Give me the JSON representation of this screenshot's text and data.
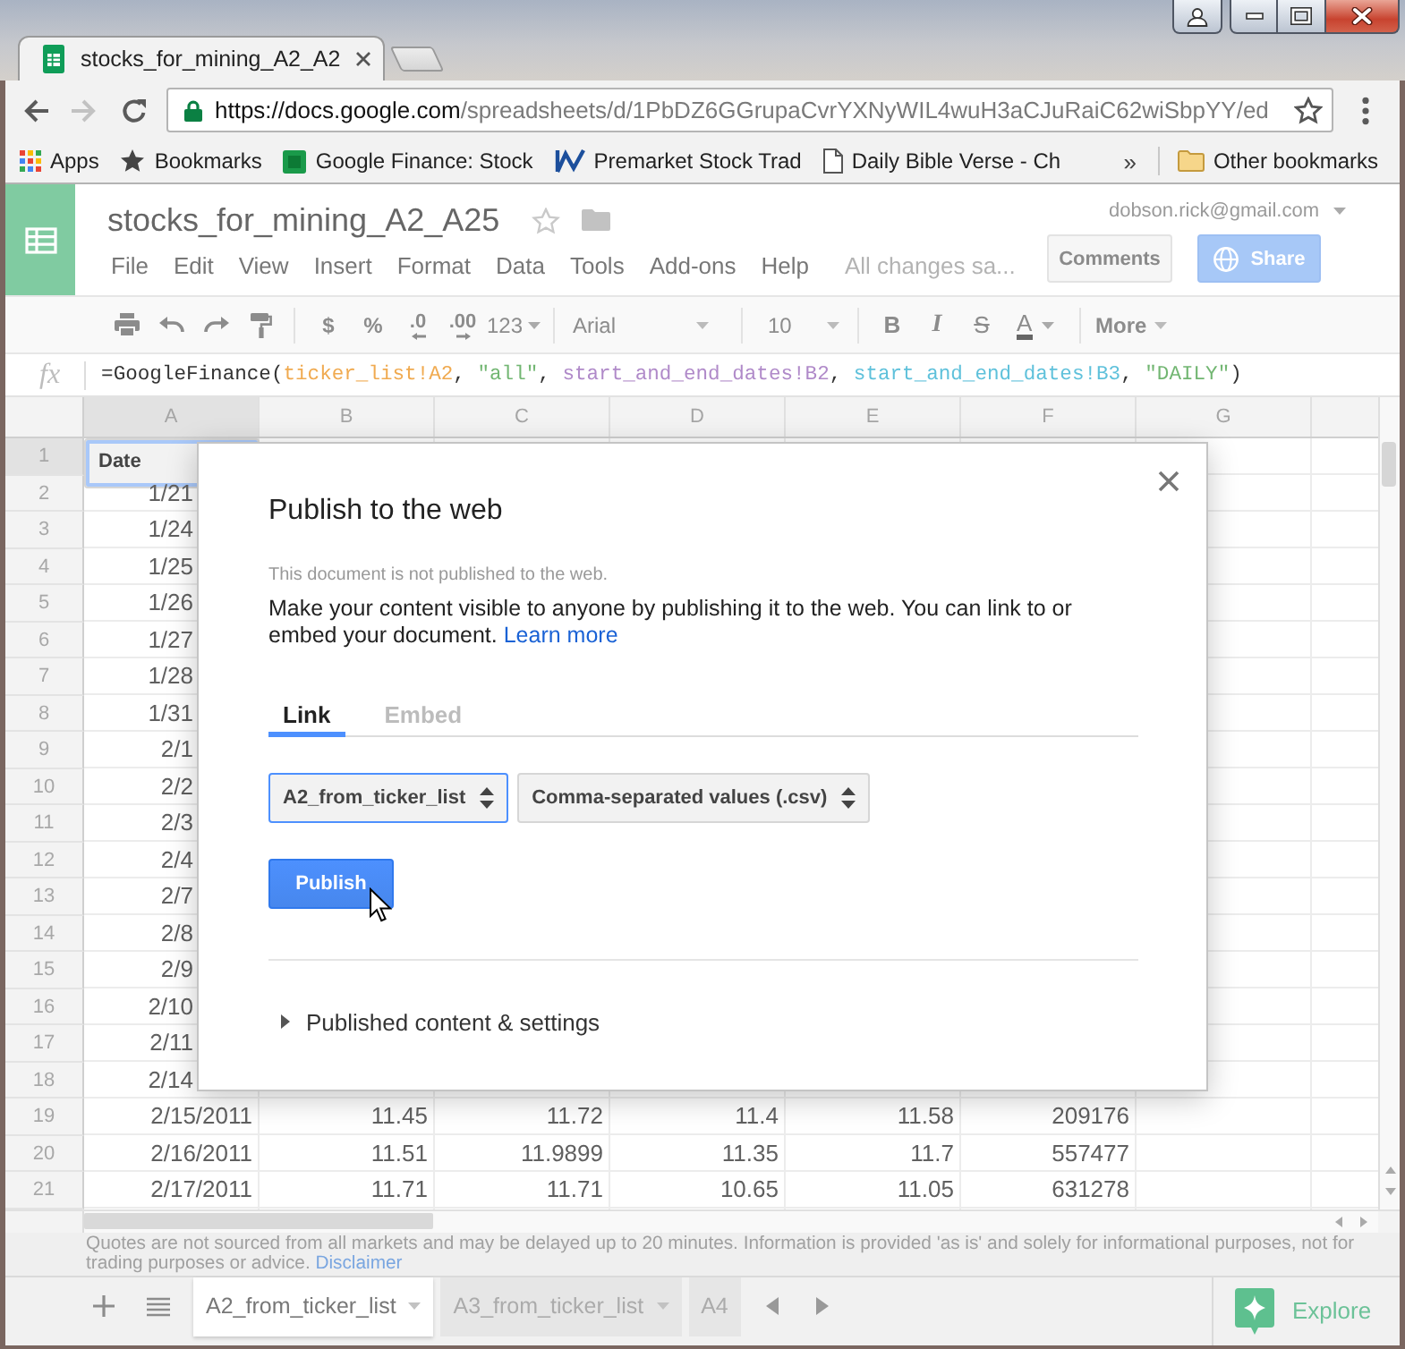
{
  "browser": {
    "tab": {
      "title": "stocks_for_mining_A2_A2"
    },
    "address": {
      "url": "https://docs.google.com/spreadsheets/d/1PbDZ6GGrupaCvrYXNyWIL4wuH3aCJuRaiC62wiSbpYY/ed"
    },
    "bookmarks": [
      {
        "label": "Apps",
        "kind": "apps"
      },
      {
        "label": "Bookmarks",
        "kind": "star"
      },
      {
        "label": "Google Finance: Stock",
        "kind": "sheet"
      },
      {
        "label": "Premarket Stock Trad",
        "kind": "chart"
      },
      {
        "label": "Daily Bible Verse - Ch",
        "kind": "page"
      }
    ],
    "overflow": "»",
    "other_bookmarks": "Other bookmarks"
  },
  "header": {
    "title": "stocks_for_mining_A2_A25",
    "menu": [
      "File",
      "Edit",
      "View",
      "Insert",
      "Format",
      "Data",
      "Tools",
      "Add-ons",
      "Help"
    ],
    "save_status": "All changes sa...",
    "account": "dobson.rick@gmail.com",
    "comments_button": "Comments",
    "share_button": "Share"
  },
  "toolbar": {
    "currency": "$",
    "percent": "%",
    "decimal_less": ".0",
    "decimal_more": ".00",
    "number_format": "123",
    "font": "Arial",
    "font_size": "10",
    "bold": "B",
    "italic": "I",
    "strikethrough": "S",
    "text_color": "A",
    "more": "More"
  },
  "formula_bar": {
    "label": "fx",
    "segments": [
      {
        "text": "=GoogleFinance(",
        "color": "#333333"
      },
      {
        "text": "ticker_list!A2",
        "color": "#f0aa50"
      },
      {
        "text": ", ",
        "color": "#333333"
      },
      {
        "text": "\"all\"",
        "color": "#72b672"
      },
      {
        "text": ", ",
        "color": "#333333"
      },
      {
        "text": "start_and_end_dates!B2",
        "color": "#b08ac9"
      },
      {
        "text": ", ",
        "color": "#333333"
      },
      {
        "text": "start_and_end_dates!B3",
        "color": "#5fc1db"
      },
      {
        "text": ", ",
        "color": "#333333"
      },
      {
        "text": "\"DAILY\"",
        "color": "#72b672"
      },
      {
        "text": ")",
        "color": "#333333"
      }
    ]
  },
  "grid": {
    "columns": [
      "A",
      "B",
      "C",
      "D",
      "E",
      "F",
      "G"
    ],
    "rows": [
      {
        "number": "1",
        "cells": [
          {
            "text": "Date",
            "kind": "text",
            "selected": true
          }
        ]
      },
      {
        "number": "2",
        "cells": [
          {
            "text": "1/21",
            "kind": "number",
            "selected": false
          }
        ]
      },
      {
        "number": "3",
        "cells": [
          {
            "text": "1/24",
            "kind": "number",
            "selected": false
          }
        ]
      },
      {
        "number": "4",
        "cells": [
          {
            "text": "1/25",
            "kind": "number",
            "selected": false
          }
        ]
      },
      {
        "number": "5",
        "cells": [
          {
            "text": "1/26",
            "kind": "number",
            "selected": false
          }
        ]
      },
      {
        "number": "6",
        "cells": [
          {
            "text": "1/27",
            "kind": "number",
            "selected": false
          }
        ]
      },
      {
        "number": "7",
        "cells": [
          {
            "text": "1/28",
            "kind": "number",
            "selected": false
          }
        ]
      },
      {
        "number": "8",
        "cells": [
          {
            "text": "1/31",
            "kind": "number",
            "selected": false
          }
        ]
      },
      {
        "number": "9",
        "cells": [
          {
            "text": "2/1",
            "kind": "number",
            "selected": false
          }
        ]
      },
      {
        "number": "10",
        "cells": [
          {
            "text": "2/2",
            "kind": "number",
            "selected": false
          }
        ]
      },
      {
        "number": "11",
        "cells": [
          {
            "text": "2/3",
            "kind": "number",
            "selected": false
          }
        ]
      },
      {
        "number": "12",
        "cells": [
          {
            "text": "2/4",
            "kind": "number",
            "selected": false
          }
        ]
      },
      {
        "number": "13",
        "cells": [
          {
            "text": "2/7",
            "kind": "number",
            "selected": false
          }
        ]
      },
      {
        "number": "14",
        "cells": [
          {
            "text": "2/8",
            "kind": "number",
            "selected": false
          }
        ]
      },
      {
        "number": "15",
        "cells": [
          {
            "text": "2/9",
            "kind": "number",
            "selected": false
          }
        ]
      },
      {
        "number": "16",
        "cells": [
          {
            "text": "2/10",
            "kind": "number",
            "selected": false
          }
        ]
      },
      {
        "number": "17",
        "cells": [
          {
            "text": "2/11",
            "kind": "number",
            "selected": false
          }
        ]
      },
      {
        "number": "18",
        "cells": [
          {
            "text": "2/14",
            "kind": "number",
            "selected": false
          }
        ]
      },
      {
        "number": "19",
        "cells": [
          {
            "text": "2/15/2011",
            "kind": "number",
            "selected": false
          },
          {
            "text": "11.45",
            "kind": "number",
            "selected": false
          },
          {
            "text": "11.72",
            "kind": "number",
            "selected": false
          },
          {
            "text": "11.4",
            "kind": "number",
            "selected": false
          },
          {
            "text": "11.58",
            "kind": "number",
            "selected": false
          },
          {
            "text": "209176",
            "kind": "number",
            "selected": false
          }
        ]
      },
      {
        "number": "20",
        "cells": [
          {
            "text": "2/16/2011",
            "kind": "number",
            "selected": false
          },
          {
            "text": "11.51",
            "kind": "number",
            "selected": false
          },
          {
            "text": "11.9899",
            "kind": "number",
            "selected": false
          },
          {
            "text": "11.35",
            "kind": "number",
            "selected": false
          },
          {
            "text": "11.7",
            "kind": "number",
            "selected": false
          },
          {
            "text": "557477",
            "kind": "number",
            "selected": false
          }
        ]
      },
      {
        "number": "21",
        "cells": [
          {
            "text": "2/17/2011",
            "kind": "number",
            "selected": false
          },
          {
            "text": "11.71",
            "kind": "number",
            "selected": false
          },
          {
            "text": "11.71",
            "kind": "number",
            "selected": false
          },
          {
            "text": "10.65",
            "kind": "number",
            "selected": false
          },
          {
            "text": "11.05",
            "kind": "number",
            "selected": false
          },
          {
            "text": "631278",
            "kind": "number",
            "selected": false
          }
        ]
      }
    ]
  },
  "footer": {
    "disclaimer": "Quotes are not sourced from all markets and may be delayed up to 20 minutes. Information is provided 'as is' and solely for informational purposes, not for trading purposes or advice.",
    "disclaimer_link": "Disclaimer"
  },
  "sheet_tabs": [
    {
      "label": "A2_from_ticker_list",
      "selected": true
    },
    {
      "label": "A3_from_ticker_list",
      "selected": false
    },
    {
      "label": "A4",
      "selected": false
    }
  ],
  "explore": "Explore",
  "dialog": {
    "title": "Publish to the web",
    "status": "This document is not published to the web.",
    "description": "Make your content visible to anyone by publishing it to the web. You can link to or embed your document.",
    "link": "Learn more",
    "tabs": [
      {
        "label": "Link",
        "selected": true
      },
      {
        "label": "Embed",
        "selected": false
      }
    ],
    "selects": [
      {
        "value": "A2_from_ticker_list",
        "focused": true
      },
      {
        "value": "Comma-separated values (.csv)",
        "focused": false
      }
    ],
    "publish_button": "Publish",
    "section": {
      "label": "Published content & settings",
      "expanded": false
    }
  }
}
